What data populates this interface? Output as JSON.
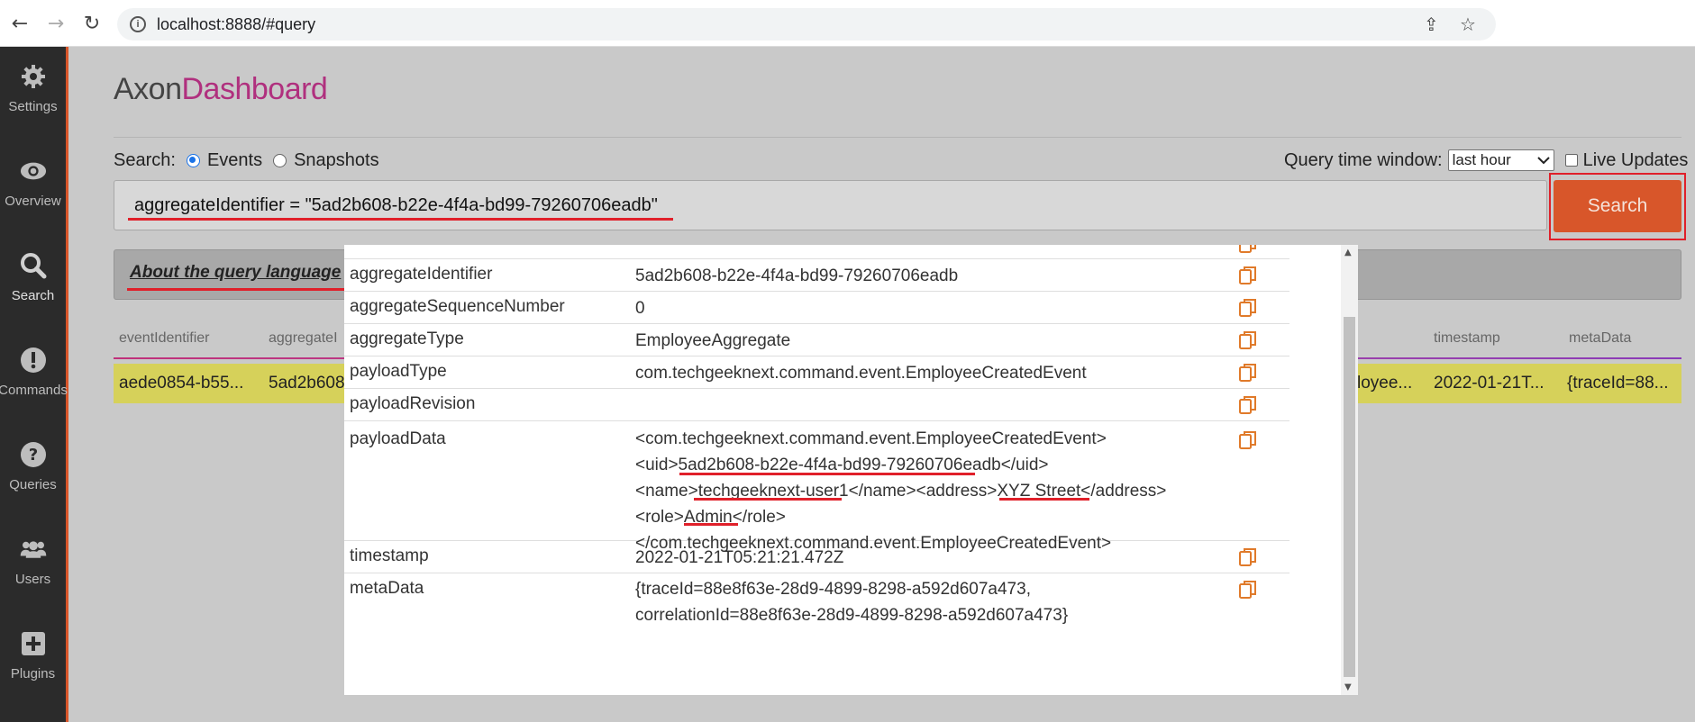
{
  "browser": {
    "url": "localhost:8888/#query"
  },
  "sidebar": {
    "items": [
      {
        "label": "Settings",
        "icon": "gear-icon"
      },
      {
        "label": "Overview",
        "icon": "eye-icon"
      },
      {
        "label": "Search",
        "icon": "search-icon"
      },
      {
        "label": "Commands",
        "icon": "exclamation-icon"
      },
      {
        "label": "Queries",
        "icon": "question-icon"
      },
      {
        "label": "Users",
        "icon": "users-icon"
      },
      {
        "label": "Plugins",
        "icon": "plus-square-icon"
      }
    ]
  },
  "logo": {
    "part1": "Axon",
    "part2": "Dashboard"
  },
  "search": {
    "label": "Search:",
    "option_events": "Events",
    "option_snapshots": "Snapshots",
    "selected": "Events",
    "query_time_label": "Query time window:",
    "query_time_value": "last hour",
    "live_updates_label": "Live Updates",
    "query_text": "aggregateIdentifier = \"5ad2b608-b22e-4f4a-bd99-79260706eadb\"",
    "button_label": "Search"
  },
  "about_link": "About the query language",
  "table": {
    "headers": [
      "eventIdentifier",
      "aggregateI",
      "timestamp",
      "metaData"
    ],
    "row": [
      "aede0854-b55...",
      "5ad2b608",
      "loyee...",
      "2022-01-21T...",
      "{traceId=88..."
    ]
  },
  "modal": {
    "rows": [
      {
        "key": "aggregateIdentifier",
        "value": "5ad2b608-b22e-4f4a-bd99-79260706eadb"
      },
      {
        "key": "aggregateSequenceNumber",
        "value": "0"
      },
      {
        "key": "aggregateType",
        "value": "EmployeeAggregate"
      },
      {
        "key": "payloadType",
        "value": "com.techgeeknext.command.event.EmployeeCreatedEvent"
      },
      {
        "key": "payloadRevision",
        "value": ""
      },
      {
        "key": "payloadData",
        "lines": [
          "<com.techgeeknext.command.event.EmployeeCreatedEvent>",
          "<uid>5ad2b608-b22e-4f4a-bd99-79260706eadb</uid>",
          "<name>techgeeknext-user1</name><address>XYZ Street</address>",
          "<role>Admin</role>",
          "</com.techgeeknext.command.event.EmployeeCreatedEvent>"
        ]
      },
      {
        "key": "timestamp",
        "value": "2022-01-21T05:21:21.472Z"
      },
      {
        "key": "metaData",
        "lines": [
          "{traceId=88e8f63e-28d9-4899-8298-a592d607a473,",
          "correlationId=88e8f63e-28d9-4899-8298-a592d607a473}"
        ]
      }
    ]
  },
  "colors": {
    "accent": "#d8562a",
    "brand_magenta": "#b0307e",
    "highlight_row": "#d6d15a",
    "annotation_red": "#e0202a"
  }
}
